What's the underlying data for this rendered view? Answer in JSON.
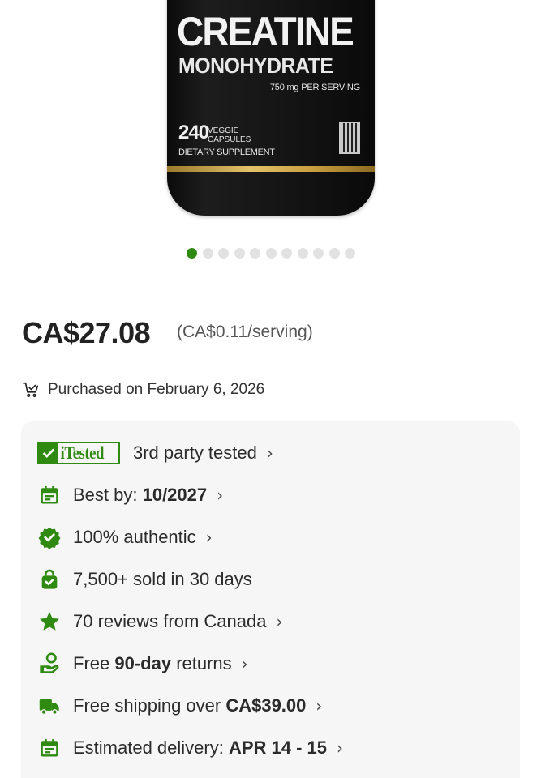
{
  "product_image": {
    "line1": "CREATINE",
    "line2": "MONOHYDRATE",
    "serving": "750 mg PER SERVING",
    "count": "240",
    "count_unit": "VEGGIE\nCAPSULES",
    "supplement": "DIETARY SUPPLEMENT",
    "carousel": {
      "total": 11,
      "active_index": 0
    }
  },
  "price": {
    "amount": "CA$27.08",
    "per_unit": "(CA$0.11/serving)"
  },
  "purchase_note": "Purchased on February 6, 2026",
  "info_card": {
    "itested_badge": "iTested",
    "rows": [
      {
        "icon": "itested-badge-icon",
        "text": "3rd party tested",
        "chevron": true
      },
      {
        "icon": "calendar-icon",
        "text": "Best by: ",
        "bold": "10/2027",
        "chevron": true
      },
      {
        "icon": "verified-badge-icon",
        "text": "100% authentic",
        "chevron": true
      },
      {
        "icon": "shopping-bag-icon",
        "text": "7,500+ sold in 30 days",
        "chevron": false
      },
      {
        "icon": "star-icon",
        "text": "70 reviews from Canada",
        "chevron": true
      },
      {
        "icon": "returns-hand-icon",
        "pre": "Free ",
        "bold": "90-day",
        "post": " returns",
        "chevron": true
      },
      {
        "icon": "truck-icon",
        "pre": "Free shipping over ",
        "bold": "CA$39.00",
        "chevron": true
      },
      {
        "icon": "calendar-icon",
        "pre": "Estimated delivery: ",
        "bold": "APR 14 - 15",
        "chevron": true
      }
    ]
  },
  "colors": {
    "accent_green": "#2f8a12",
    "card_bg": "#f6f6f6"
  },
  "chevron_glyph": "›"
}
